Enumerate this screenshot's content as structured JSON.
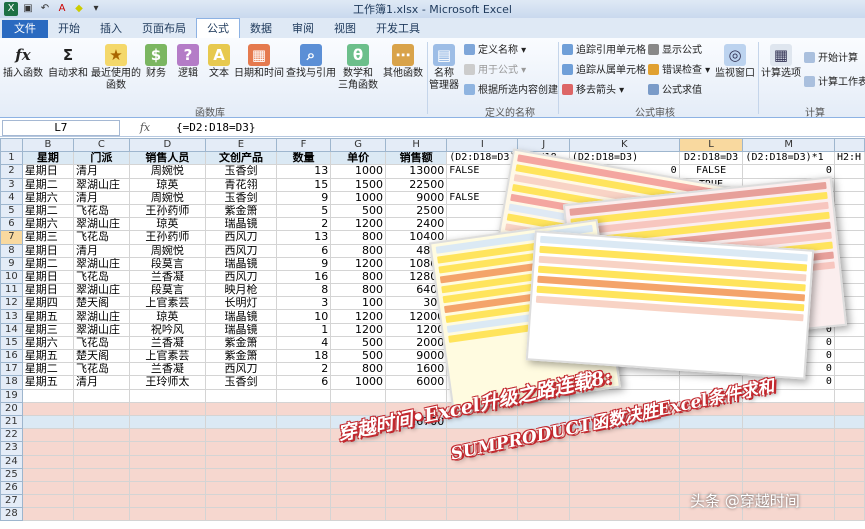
{
  "window": {
    "title": "工作簿1.xlsx - Microsoft Excel"
  },
  "tabs": [
    "文件",
    "开始",
    "插入",
    "页面布局",
    "公式",
    "数据",
    "审阅",
    "视图",
    "开发工具"
  ],
  "ribbon": {
    "function_library": {
      "insert_function": "插入函数",
      "autosum": "自动求和",
      "recent_1": "最近使用的",
      "recent_2": "函数",
      "finance": "财务",
      "logic": "逻辑",
      "text": "文本",
      "datetime": "日期和时间",
      "lookup": "查找与引用",
      "math_1": "数学和",
      "math_2": "三角函数",
      "other": "其他函数",
      "group_label": "函数库"
    },
    "defined_names": {
      "name_manager_1": "名称",
      "name_manager_2": "管理器",
      "define_name": "定义名称",
      "use_in_formula": "用于公式",
      "create_from_selection": "根据所选内容创建",
      "group_label": "定义的名称"
    },
    "formula_auditing": {
      "trace_precedents": "追踪引用单元格",
      "trace_dependents": "追踪从属单元格",
      "remove_arrows": "移去箭头",
      "show_formulas": "显示公式",
      "error_checking": "错误检查",
      "evaluate_formula": "公式求值",
      "watch_window": "监视窗口",
      "group_label": "公式审核"
    },
    "calculation": {
      "calc_options": "计算选项",
      "calc_now": "开始计算",
      "calc_sheet": "计算工作表",
      "group_label": "计算"
    }
  },
  "formula_bar": {
    "name_box": "L7",
    "fx": "fx",
    "formula": "{=D2:D18=D3}"
  },
  "columns": [
    "B",
    "C",
    "D",
    "E",
    "F",
    "G",
    "H",
    "I",
    "J",
    "K",
    "L",
    "M"
  ],
  "table": {
    "headers": [
      "星期",
      "门派",
      "销售人员",
      "文创产品",
      "数量",
      "单价",
      "销售额"
    ],
    "rows": [
      [
        "星期日",
        "清月",
        "周婉悦",
        "玉香剑",
        "13",
        "1000",
        "13000"
      ],
      [
        "星期二",
        "翠湖山庄",
        "琼英",
        "青花翎",
        "15",
        "1500",
        "22500"
      ],
      [
        "星期六",
        "清月",
        "周婉悦",
        "玉香剑",
        "9",
        "1000",
        "9000"
      ],
      [
        "星期二",
        "飞花岛",
        "王孙药师",
        "紫金箫",
        "5",
        "500",
        "2500"
      ],
      [
        "星期六",
        "翠湖山庄",
        "琼英",
        "瑞晶镜",
        "2",
        "1200",
        "2400"
      ],
      [
        "星期三",
        "飞花岛",
        "王孙药师",
        "西风刀",
        "13",
        "800",
        "10400"
      ],
      [
        "星期日",
        "清月",
        "周婉悦",
        "西风刀",
        "6",
        "800",
        "4800"
      ],
      [
        "星期二",
        "翠湖山庄",
        "段莫言",
        "瑞晶镜",
        "9",
        "1200",
        "10800"
      ],
      [
        "星期日",
        "飞花岛",
        "兰香凝",
        "西风刀",
        "16",
        "800",
        "12800"
      ],
      [
        "星期日",
        "翠湖山庄",
        "段莫言",
        "映月枪",
        "8",
        "800",
        "6400"
      ],
      [
        "星期四",
        "楚天阁",
        "上官素芸",
        "长明灯",
        "3",
        "100",
        "300"
      ],
      [
        "星期五",
        "翠湖山庄",
        "琼英",
        "瑞晶镜",
        "10",
        "1200",
        "12000"
      ],
      [
        "星期三",
        "翠湖山庄",
        "祝吟风",
        "瑞晶镜",
        "1",
        "1200",
        "1200"
      ],
      [
        "星期六",
        "飞花岛",
        "兰香凝",
        "紫金箫",
        "4",
        "500",
        "2000"
      ],
      [
        "星期五",
        "楚天阁",
        "上官素芸",
        "紫金箫",
        "18",
        "500",
        "9000"
      ],
      [
        "星期二",
        "飞花岛",
        "兰香凝",
        "西风刀",
        "2",
        "800",
        "1600"
      ],
      [
        "星期五",
        "清月",
        "王玲师太",
        "玉香剑",
        "6",
        "1000",
        "6000"
      ]
    ],
    "total": "126700"
  },
  "side_cols": {
    "i_header": "(D2:D18=D3)",
    "j_header": "H2:H18",
    "k_header": "(D2:D18=D3)",
    "l_header": "D2:D18=D3",
    "m_header": "(D2:D18=D3)*1",
    "n_header": "H2:H",
    "i_vals": [
      "FALSE",
      "",
      "FALSE",
      "",
      "",
      "",
      "",
      "",
      "",
      "",
      "TRU",
      "FALSE",
      "FALSE",
      "FALSE",
      "FALSE",
      "FALSE",
      "FALSE"
    ],
    "l_vals": [
      "FALSE",
      "TRUE",
      "FALSE",
      "",
      "",
      "",
      "",
      "",
      "",
      "",
      "",
      "",
      "",
      "",
      "",
      "",
      ""
    ],
    "m_vals": [
      "0",
      "1",
      "0",
      "",
      "",
      "",
      "",
      "",
      "",
      "",
      "",
      "",
      "0",
      "0",
      "0",
      "0",
      "0"
    ],
    "k_vals": [
      "0",
      "",
      "0",
      "",
      "",
      "",
      "",
      "",
      "",
      "",
      "",
      "",
      "",
      "",
      "",
      "",
      ""
    ]
  },
  "captions": {
    "line1": "穿越时间•Excel升级之路连载8:",
    "line2": "SUMPRODUCT函数决胜Excel条件求和",
    "watermark": "头条 @穿越时间"
  },
  "colors": {
    "header_band": "#dbe9f4",
    "pink_area": "#f6d7cf",
    "caption_red": "#c2282e",
    "file_tab": "#2a6ac0"
  }
}
